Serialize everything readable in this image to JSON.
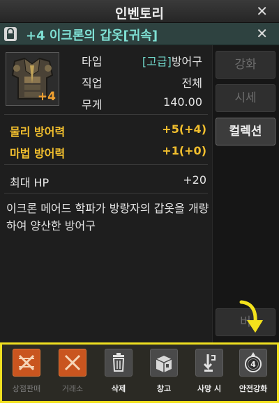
{
  "window": {
    "title": "인벤토리",
    "close": "✕"
  },
  "item": {
    "name": "+4 이크론의 갑옷[귀속]",
    "enchant": "+4",
    "close": "✕",
    "info": [
      {
        "label": "타입",
        "grade": "[고급]",
        "value": "방어구"
      },
      {
        "label": "직업",
        "value": "전체"
      },
      {
        "label": "무게",
        "value": "140.00"
      }
    ],
    "stats": [
      {
        "label": "물리 방어력",
        "value": "+5(+4)"
      },
      {
        "label": "마법 방어력",
        "value": "+1(+0)"
      }
    ],
    "extra_stat": {
      "label": "최대 HP",
      "value": "+20"
    },
    "description": "이크론 메어드 학파가 방랑자의 갑옷을 개량하여 양산한 방어구"
  },
  "side_buttons": [
    {
      "label": "강화",
      "active": false
    },
    {
      "label": "시세",
      "active": false
    },
    {
      "label": "컬렉션",
      "active": true
    },
    {
      "label": "버",
      "active": false
    }
  ],
  "actions": [
    {
      "label": "상점판매",
      "enabled": false,
      "icon": "disabled-x-icon"
    },
    {
      "label": "거래소",
      "enabled": false,
      "icon": "disabled-x-icon"
    },
    {
      "label": "삭제",
      "enabled": true,
      "icon": "trash-icon"
    },
    {
      "label": "창고",
      "enabled": true,
      "icon": "storage-box-icon"
    },
    {
      "label": "사망 시",
      "enabled": true,
      "icon": "death-drop-icon"
    },
    {
      "label": "안전강화",
      "enabled": true,
      "icon": "safe-enchant-icon",
      "badge": "4"
    }
  ],
  "colors": {
    "highlight": "#f0e020",
    "stat_gold": "#f2bf2e",
    "item_name": "#7fe0d4",
    "enchant_orange": "#f0a030"
  }
}
